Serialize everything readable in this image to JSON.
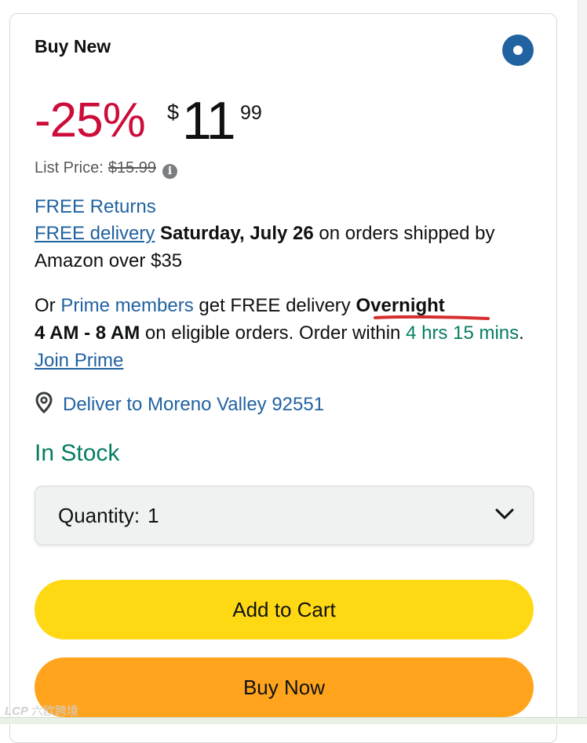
{
  "card": {
    "title": "Buy New"
  },
  "price": {
    "discount": "-25%",
    "symbol": "$",
    "whole": "11",
    "fraction": "99",
    "list_price_label": "List Price:",
    "list_price_value": "$15.99",
    "info_icon": "info-icon"
  },
  "delivery": {
    "free_returns": "FREE Returns",
    "free_delivery_link": "FREE delivery",
    "date": "Saturday, July 26",
    "condition": "on orders shipped by Amazon over $35",
    "prime_prefix": "Or",
    "prime_members_link": "Prime members",
    "prime_mid": "get FREE delivery",
    "overnight": "Overnight",
    "time_window": "4 AM - 8 AM",
    "eligible_text": "on eligible orders. Order within",
    "countdown": "4 hrs 15 mins",
    "period": ".",
    "join_prime_link": "Join Prime",
    "annotation_color": "#d62f2f"
  },
  "location": {
    "icon": "location-pin-icon",
    "text": "Deliver to Moreno Valley 92551"
  },
  "stock": {
    "status": "In Stock",
    "color": "#067d62"
  },
  "quantity": {
    "label": "Quantity:",
    "value": "1",
    "icon": "chevron-down-icon"
  },
  "buttons": {
    "add_to_cart": "Add to Cart",
    "buy_now": "Buy Now",
    "add_to_cart_color": "#ffd814",
    "buy_now_color": "#ffa41c"
  },
  "watermark": {
    "logo": "LCP",
    "text": "六欧跨境"
  }
}
